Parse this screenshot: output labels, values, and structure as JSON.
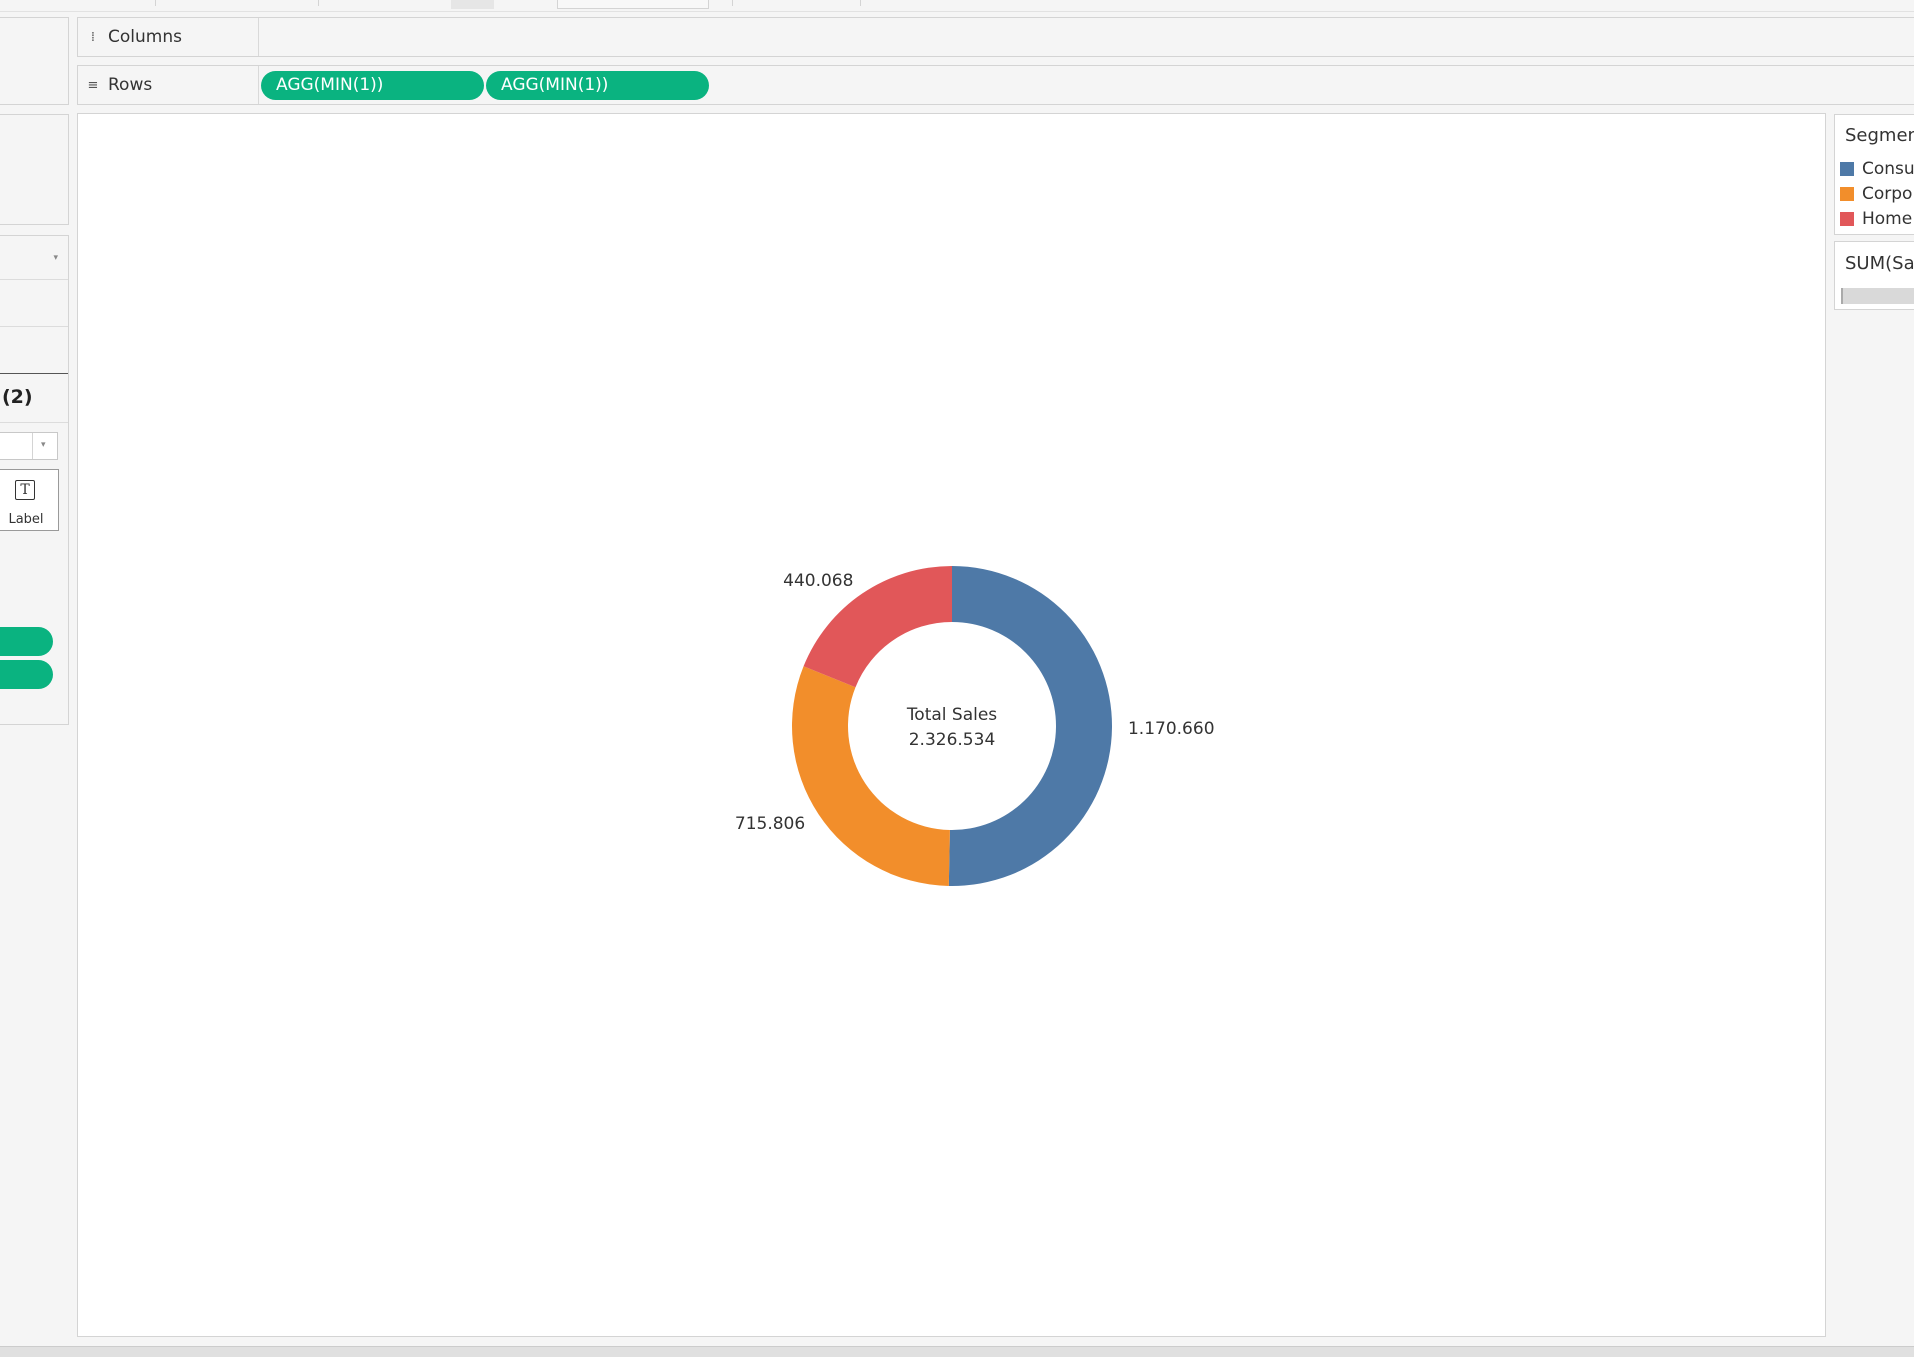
{
  "shelves": {
    "columns": {
      "label": "Columns",
      "icon": "columns-icon"
    },
    "rows": {
      "label": "Rows",
      "icon": "rows-icon",
      "pills": [
        "AGG(MIN(1))",
        "AGG(MIN(1))"
      ]
    }
  },
  "marks_card": {
    "title": "(2)",
    "label_button": "Label",
    "label_icon": "text-t-icon"
  },
  "legend": {
    "title": "Segment",
    "items": [
      {
        "label": "Consumer",
        "color": "#4e79a7"
      },
      {
        "label": "Corporate",
        "color": "#f28e2b"
      },
      {
        "label": "Home Office",
        "color": "#e15759"
      }
    ],
    "size_title": "SUM(Sales)"
  },
  "colors": {
    "pill": "#0ab380",
    "consumer": "#4e79a7",
    "corporate": "#f28e2b",
    "home_office": "#e15759"
  },
  "chart_data": {
    "type": "pie",
    "variant": "donut",
    "categories": [
      "Consumer",
      "Corporate",
      "Home Office"
    ],
    "values": [
      1170660,
      715806,
      440068
    ],
    "value_labels": [
      "1.170.660",
      "715.806",
      "440.068"
    ],
    "center_label": "Total Sales",
    "center_value": "2.326.534",
    "colors": [
      "#4e79a7",
      "#f28e2b",
      "#e15759"
    ]
  }
}
